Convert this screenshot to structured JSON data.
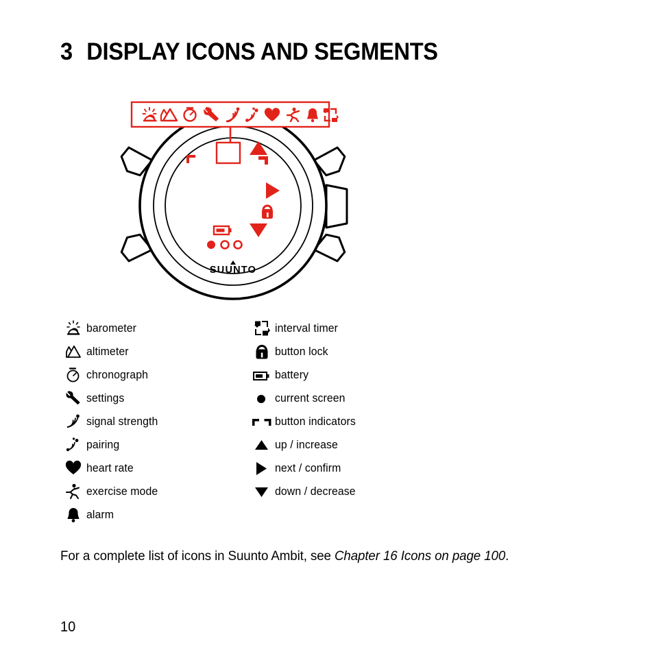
{
  "document": {
    "chapter_number": "3",
    "chapter_title": "DISPLAY ICONS AND SEGMENTS",
    "page_number": "10",
    "note_plain": "For a complete list of icons in Suunto Ambit, see ",
    "note_italic": "Chapter 16 Icons on page 100",
    "note_end": "."
  },
  "colors": {
    "accent_red": "#E2231A",
    "ink": "#000000",
    "paper": "#FFFFFF"
  },
  "figure": {
    "name": "suunto-ambit-watch-display-diagram",
    "brand_text": "SUUNTO",
    "callout_bar_icons": [
      "barometer-icon",
      "altimeter-icon",
      "chronograph-icon",
      "settings-icon",
      "signal-strength-icon",
      "pairing-icon",
      "heart-rate-icon",
      "exercise-mode-icon",
      "alarm-icon",
      "interval-timer-icon"
    ],
    "display_segments": [
      "callout-box",
      "button-indicator-top-left",
      "up-arrow",
      "button-indicator-top-right",
      "next-arrow",
      "button-lock",
      "down-arrow",
      "battery",
      "current-screen-dots"
    ],
    "screen_dots": [
      "filled",
      "hollow",
      "hollow"
    ]
  },
  "legend": {
    "left_column": [
      {
        "icon": "barometer-icon",
        "label": "barometer"
      },
      {
        "icon": "altimeter-icon",
        "label": "altimeter"
      },
      {
        "icon": "chronograph-icon",
        "label": "chronograph"
      },
      {
        "icon": "settings-icon",
        "label": "settings"
      },
      {
        "icon": "signal-strength-icon",
        "label": "signal strength"
      },
      {
        "icon": "pairing-icon",
        "label": "pairing"
      },
      {
        "icon": "heart-rate-icon",
        "label": "heart rate"
      },
      {
        "icon": "exercise-mode-icon",
        "label": "exercise mode"
      },
      {
        "icon": "alarm-icon",
        "label": "alarm"
      }
    ],
    "right_column": [
      {
        "icon": "interval-timer-icon",
        "label": "interval timer"
      },
      {
        "icon": "button-lock-icon",
        "label": "button lock"
      },
      {
        "icon": "battery-icon",
        "label": "battery"
      },
      {
        "icon": "current-screen-icon",
        "label": "current screen"
      },
      {
        "icon": "button-indicators-icon",
        "label": "button indicators"
      },
      {
        "icon": "up-arrow-icon",
        "label": "up / increase"
      },
      {
        "icon": "next-arrow-icon",
        "label": "next / confirm"
      },
      {
        "icon": "down-arrow-icon",
        "label": "down / decrease"
      }
    ]
  }
}
